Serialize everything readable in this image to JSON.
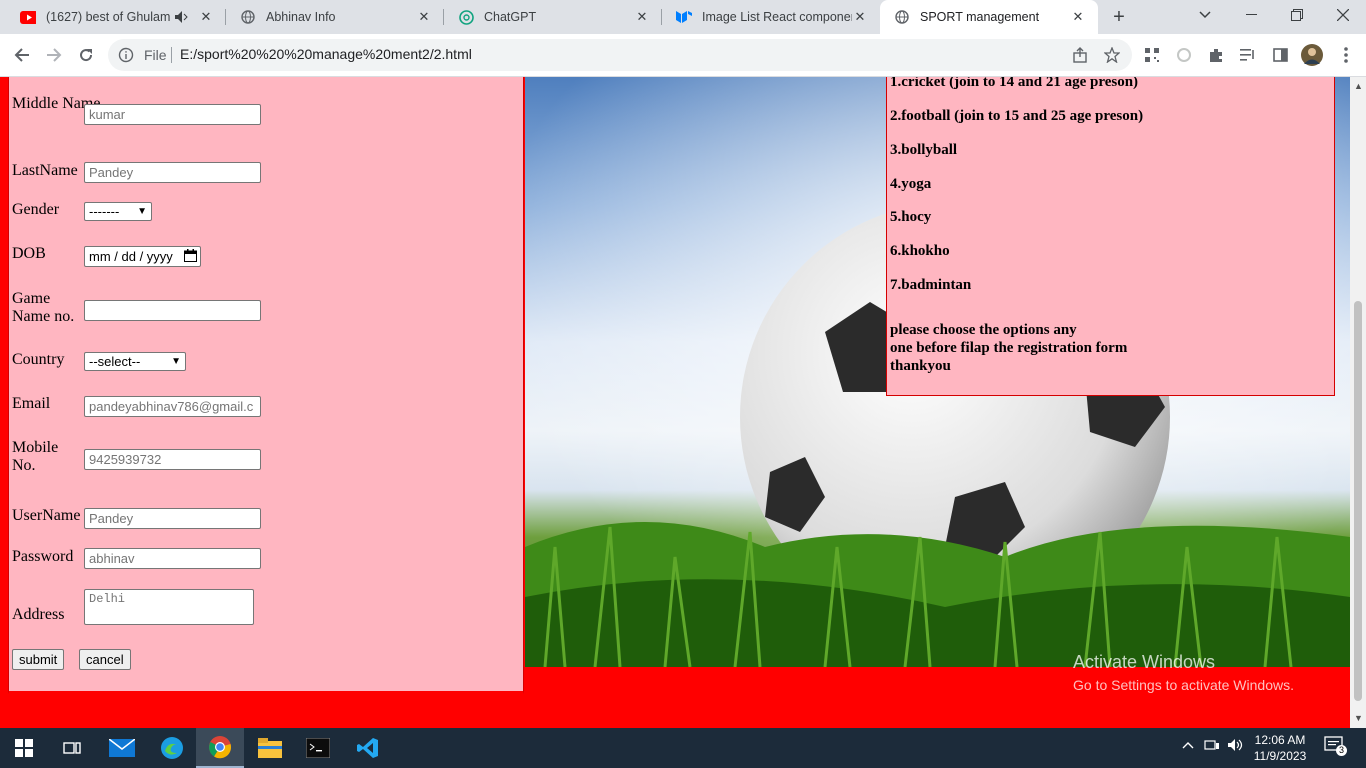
{
  "browser": {
    "tabs": [
      {
        "title": "(1627) best of Ghulam a",
        "icon": "youtube-icon",
        "audio": true
      },
      {
        "title": "Abhinav Info",
        "icon": "globe-icon"
      },
      {
        "title": "ChatGPT",
        "icon": "chatgpt-icon"
      },
      {
        "title": "Image List React component",
        "icon": "mui-icon"
      },
      {
        "title": "SPORT management",
        "icon": "globe-icon",
        "active": true
      }
    ],
    "omnibox": {
      "scheme_label": "File",
      "url": "E:/sport%20%20%20manage%20ment2/2.html"
    }
  },
  "form": {
    "fields": [
      {
        "label": "Middle Name",
        "value": "kumar"
      },
      {
        "label": "LastName",
        "value": "Pandey"
      },
      {
        "label": "Gender",
        "value": "-------"
      },
      {
        "label": "DOB",
        "value": "mm / dd / yyyy"
      },
      {
        "label": "Game Name no.",
        "value": ""
      },
      {
        "label": "Country",
        "value": "--select--"
      },
      {
        "label": "Email",
        "value": "pandeyabhinav786@gmail.c"
      },
      {
        "label": "Mobile No.",
        "value": "9425939732"
      },
      {
        "label": "UserName",
        "value": "Pandey"
      },
      {
        "label": "Password",
        "value": "abhinav"
      },
      {
        "label": "Address",
        "value": "Delhi"
      }
    ],
    "submit_label": "submit",
    "cancel_label": "cancel"
  },
  "rules": {
    "items": [
      "1.cricket (join to 14 and 21 age preson)",
      "2.football (join to 15 and 25 age preson)",
      "3.bollyball",
      "4.yoga",
      "5.hocy",
      "6.khokho",
      "7.badmintan"
    ],
    "note": [
      "please choose the options any",
      "one before filap the registration form",
      "thankyou"
    ]
  },
  "watermark": {
    "line1": "Activate Windows",
    "line2": "Go to Settings to activate Windows."
  },
  "taskbar": {
    "time": "12:06 AM",
    "date": "11/9/2023",
    "notifications": "3",
    "colors": {
      "accent": "#ffb6c1",
      "page_bg": "#ff0000"
    }
  }
}
